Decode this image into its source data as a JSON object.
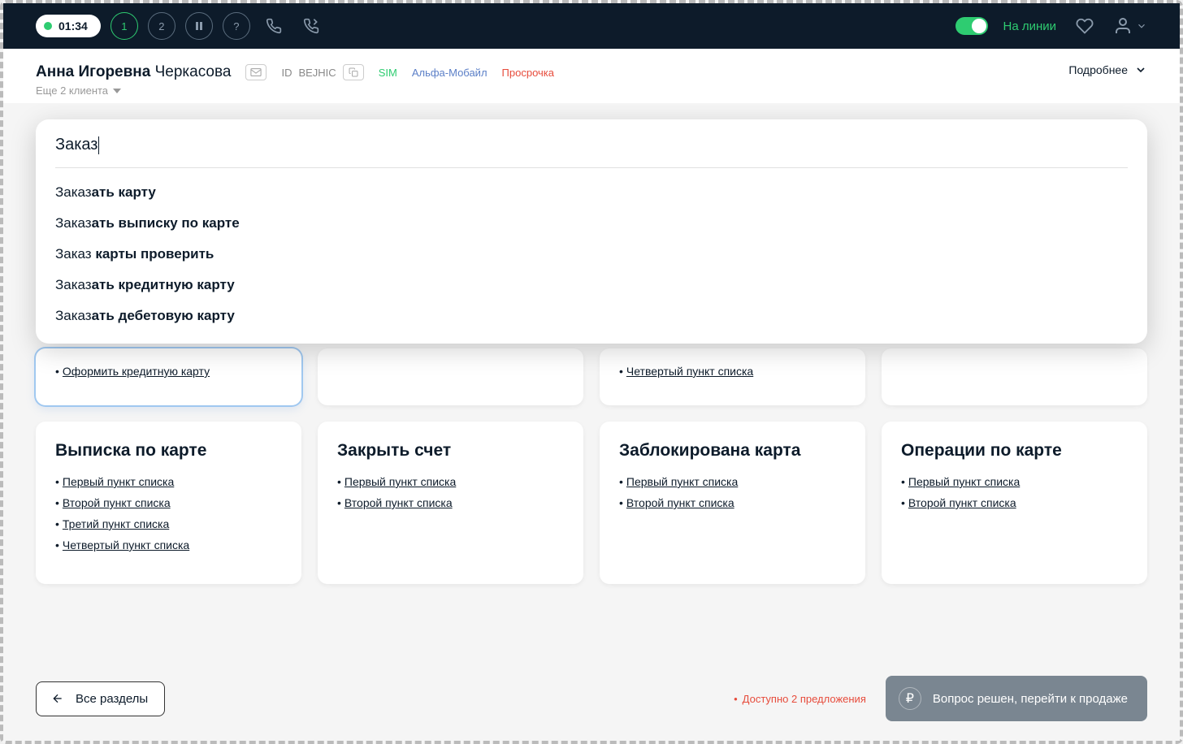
{
  "topbar": {
    "timer": "01:34",
    "queue1": "1",
    "queue2": "2",
    "online_label": "На линии"
  },
  "client": {
    "name_bold": "Анна Игоревна",
    "name_rest": " Черкасова",
    "id_prefix": "ID",
    "id": "BEJHIC",
    "tag_sim": "SIM",
    "tag_alpha": "Альфа-Мобайл",
    "tag_overdue": "Просрочка",
    "more_clients": "Еще 2 клиента",
    "details": "Подробнее"
  },
  "search": {
    "value": "Заказ",
    "suggestions": [
      {
        "prefix": "Заказ",
        "bold": "ать карту"
      },
      {
        "prefix": "Заказ",
        "bold": "ать выписку по карте"
      },
      {
        "prefix": "Заказ ",
        "bold": "карты проверить"
      },
      {
        "prefix": "Заказ",
        "bold": "ать кредитную карту"
      },
      {
        "prefix": "Заказ",
        "bold": "ать дебетовую карту"
      }
    ]
  },
  "peek_row": [
    {
      "item": "Оформить кредитную карту",
      "highlighted": true
    },
    {
      "item": "",
      "highlighted": false
    },
    {
      "item": "Четвертый пункт списка",
      "highlighted": false
    },
    {
      "item": "",
      "highlighted": false
    }
  ],
  "cards": [
    {
      "title": "Выписка по карте",
      "items": [
        "Первый пункт списка",
        "Второй пункт списка",
        "Третий пункт списка",
        "Четвертый пункт списка"
      ]
    },
    {
      "title": "Закрыть счет",
      "items": [
        "Первый пункт списка",
        "Второй пункт списка"
      ]
    },
    {
      "title": "Заблокирована карта",
      "items": [
        "Первый пункт списка",
        "Второй пункт списка"
      ]
    },
    {
      "title": "Операции по карте",
      "items": [
        "Первый пункт списка",
        "Второй пункт списка"
      ]
    }
  ],
  "footer": {
    "all_sections": "Все разделы",
    "offers": "Доступно 2 предложения",
    "resolve": "Вопрос решен, перейти к продаже"
  }
}
